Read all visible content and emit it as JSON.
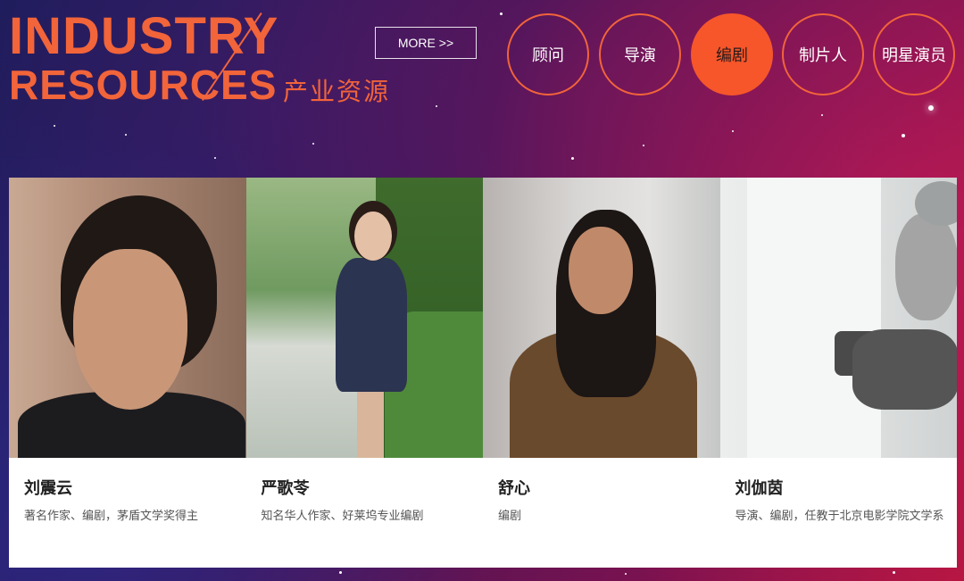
{
  "logo": {
    "line1": "INDUSTRY",
    "line2": "RESOURCES",
    "chinese": "产业资源"
  },
  "more_label": "MORE >>",
  "categories": [
    {
      "label": "顾问",
      "active": false
    },
    {
      "label": "导演",
      "active": false
    },
    {
      "label": "编剧",
      "active": true
    },
    {
      "label": "制片人",
      "active": false
    },
    {
      "label": "明星演员",
      "active": false
    }
  ],
  "people": [
    {
      "name": "刘震云",
      "desc": "著名作家、编剧，茅盾文学奖得主"
    },
    {
      "name": "严歌苓",
      "desc": "知名华人作家、好莱坞专业编剧"
    },
    {
      "name": "舒心",
      "desc": "编剧"
    },
    {
      "name": "刘伽茵",
      "desc": "导演、编剧，任教于北京电影学院文学系"
    }
  ],
  "colors": {
    "accent": "#f2643a",
    "active_bg": "#f6562a"
  }
}
